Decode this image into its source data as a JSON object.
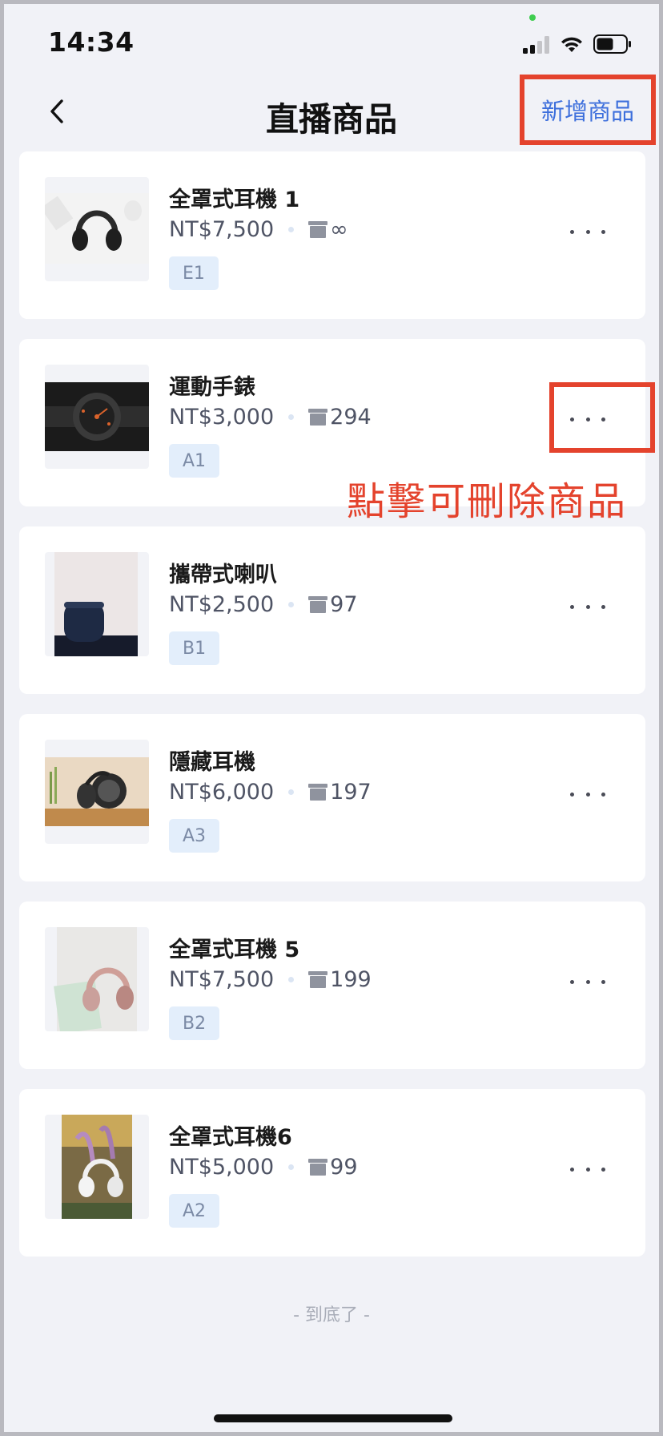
{
  "status_bar": {
    "time": "14:34",
    "signal_icon": "cellular-signal-icon",
    "wifi_icon": "wifi-icon",
    "battery_icon": "battery-icon"
  },
  "header": {
    "title": "直播商品",
    "add_label": "新增商品",
    "back_icon": "chevron-left-icon"
  },
  "products": [
    {
      "name": "全罩式耳機 1",
      "price": "NT$7,500",
      "stock": "∞",
      "tag": "E1"
    },
    {
      "name": "運動手錶",
      "price": "NT$3,000",
      "stock": "294",
      "tag": "A1"
    },
    {
      "name": "攜帶式喇叭",
      "price": "NT$2,500",
      "stock": "97",
      "tag": "B1"
    },
    {
      "name": "隱藏耳機",
      "price": "NT$6,000",
      "stock": "197",
      "tag": "A3"
    },
    {
      "name": "全罩式耳機 5",
      "price": "NT$7,500",
      "stock": "199",
      "tag": "B2"
    },
    {
      "name": "全罩式耳機6",
      "price": "NT$5,000",
      "stock": "99",
      "tag": "A2"
    }
  ],
  "annotation": {
    "hint": "點擊可刪除商品",
    "color": "#e4432d"
  },
  "footer": {
    "end_text": "- 到底了 -"
  },
  "colors": {
    "link_blue": "#3d6fdc",
    "background": "#f1f2f7",
    "tag_bg": "#e3eefb"
  }
}
